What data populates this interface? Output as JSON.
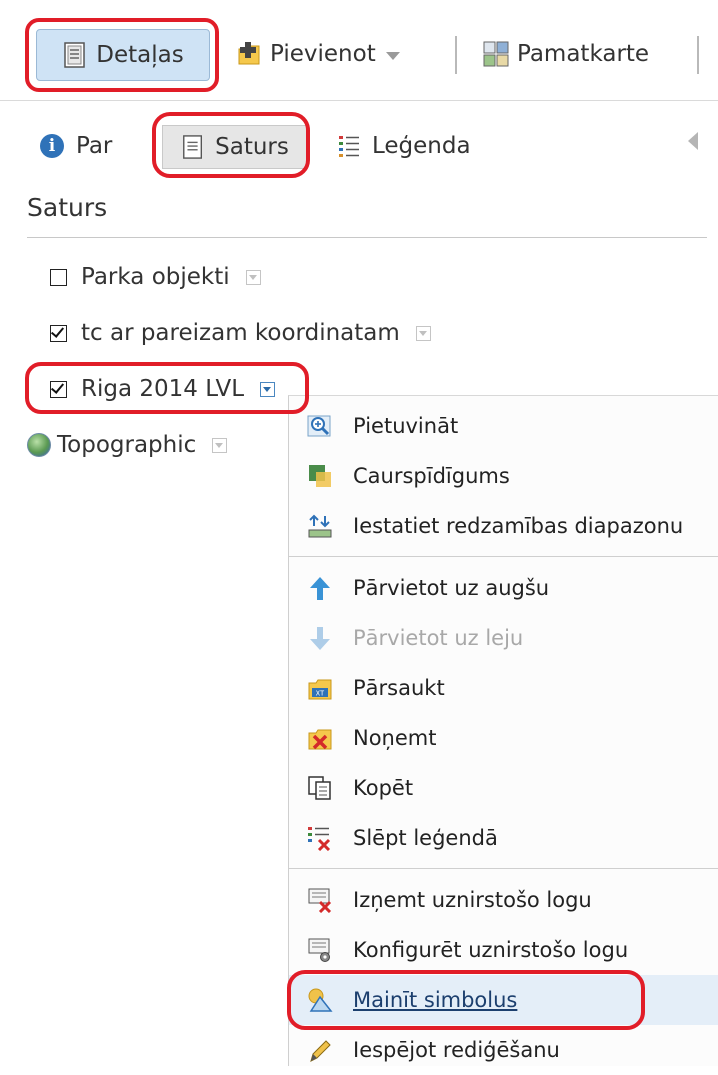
{
  "toolbar": {
    "details_label": "Detaļas",
    "add_label": "Pievienot",
    "basemap_label": "Pamatkarte"
  },
  "tabs": {
    "about": "Par",
    "content": "Saturs",
    "legend": "Leģenda"
  },
  "section_title": "Saturs",
  "layers": [
    {
      "name": "Parka objekti",
      "checked": false
    },
    {
      "name": "tc ar pareizam koordinatam",
      "checked": true
    },
    {
      "name": "Riga 2014 LVL",
      "checked": true
    }
  ],
  "basemap_layer": "Topographic",
  "context_menu": {
    "items": [
      {
        "label": "Pietuvināt",
        "icon": "zoom-icon"
      },
      {
        "label": "Caurspīdīgums",
        "icon": "transparency-icon"
      },
      {
        "label": "Iestatiet redzamības diapazonu",
        "icon": "visibility-range-icon"
      },
      {
        "label": "Pārvietot uz augšu",
        "icon": "arrow-up-icon"
      },
      {
        "label": "Pārvietot uz leju",
        "icon": "arrow-down-icon",
        "disabled": true
      },
      {
        "label": "Pārsaukt",
        "icon": "rename-icon"
      },
      {
        "label": "Noņemt",
        "icon": "remove-icon"
      },
      {
        "label": "Kopēt",
        "icon": "copy-icon"
      },
      {
        "label": "Slēpt leģendā",
        "icon": "hide-legend-icon"
      },
      {
        "label": "Izņemt uznirstošo logu",
        "icon": "remove-popup-icon"
      },
      {
        "label": "Konfigurēt uznirstošo logu",
        "icon": "configure-popup-icon"
      },
      {
        "label": "Mainīt simbolus",
        "icon": "change-symbols-icon",
        "hovered": true
      },
      {
        "label": "Iespējot rediģēšanu",
        "icon": "edit-pencil-icon"
      }
    ]
  },
  "colors": {
    "highlight_ring": "#e11d28",
    "active_button": "#cfe3f5",
    "menu_hover": "#e4eef8"
  }
}
